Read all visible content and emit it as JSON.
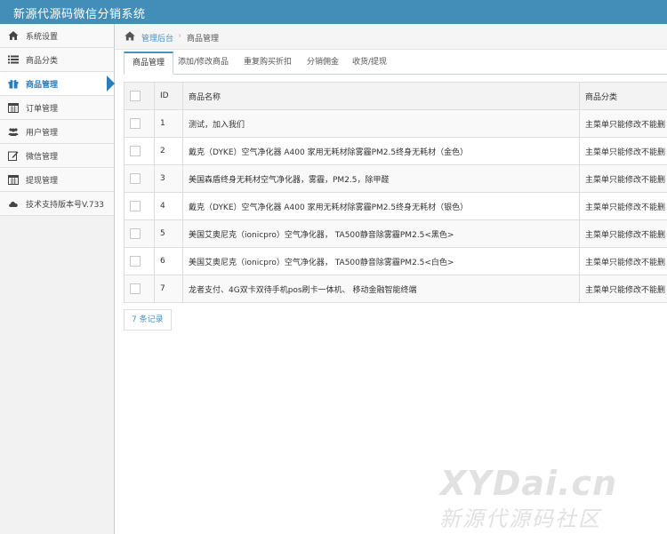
{
  "app": {
    "title": "新源代源码微信分销系统"
  },
  "sidebar": {
    "items": [
      {
        "label": "系统设置",
        "icon": "home-icon"
      },
      {
        "label": "商品分类",
        "icon": "list-icon"
      },
      {
        "label": "商品管理",
        "icon": "gift-icon",
        "active": true
      },
      {
        "label": "订单管理",
        "icon": "calendar-icon"
      },
      {
        "label": "用户管理",
        "icon": "users-icon"
      },
      {
        "label": "微信管理",
        "icon": "edit-icon"
      },
      {
        "label": "提现管理",
        "icon": "calendar-icon"
      },
      {
        "label": "技术支持版本号V.733",
        "icon": "cloud-icon"
      }
    ]
  },
  "breadcrumb": {
    "home": "管理后台",
    "current": "商品管理"
  },
  "tabs": [
    "商品管理",
    "添加/修改商品",
    "重复购买折扣",
    "分销佣金",
    "收货/提现"
  ],
  "table": {
    "headers": [
      "ID",
      "商品名称",
      "商品分类"
    ],
    "rows": [
      {
        "id": "1",
        "name": "测试，加入我们",
        "category": "主菜单只能修改不能删"
      },
      {
        "id": "2",
        "name": "戴克（DYKE）空气净化器 A400 家用无耗材除雾霾PM2.5终身无耗材（金色）",
        "category": "主菜单只能修改不能删"
      },
      {
        "id": "3",
        "name": "美国森盾终身无耗材空气净化器，雾霾，PM2.5，除甲醛",
        "category": "主菜单只能修改不能删"
      },
      {
        "id": "4",
        "name": "戴克（DYKE）空气净化器 A400 家用无耗材除雾霾PM2.5终身无耗材（银色）",
        "category": "主菜单只能修改不能删"
      },
      {
        "id": "5",
        "name": "美国艾奥尼克（ionicpro）空气净化器， TA500静音除雾霾PM2.5<黑色>",
        "category": "主菜单只能修改不能删"
      },
      {
        "id": "6",
        "name": "美国艾奥尼克（ionicpro）空气净化器， TA500静音除雾霾PM2.5<白色>",
        "category": "主菜单只能修改不能删"
      },
      {
        "id": "7",
        "name": "龙者支付、4G双卡双待手机pos刷卡一体机、 移动金融智能终端",
        "category": "主菜单只能修改不能删"
      }
    ]
  },
  "footer": {
    "record_count": "7 条记录"
  },
  "watermark": {
    "line1": "XYDai.cn",
    "line2": "新源代源码社区"
  },
  "colors": {
    "topbar": "#438eb9",
    "accent": "#2b7dbc",
    "link": "#4c8fbd"
  }
}
